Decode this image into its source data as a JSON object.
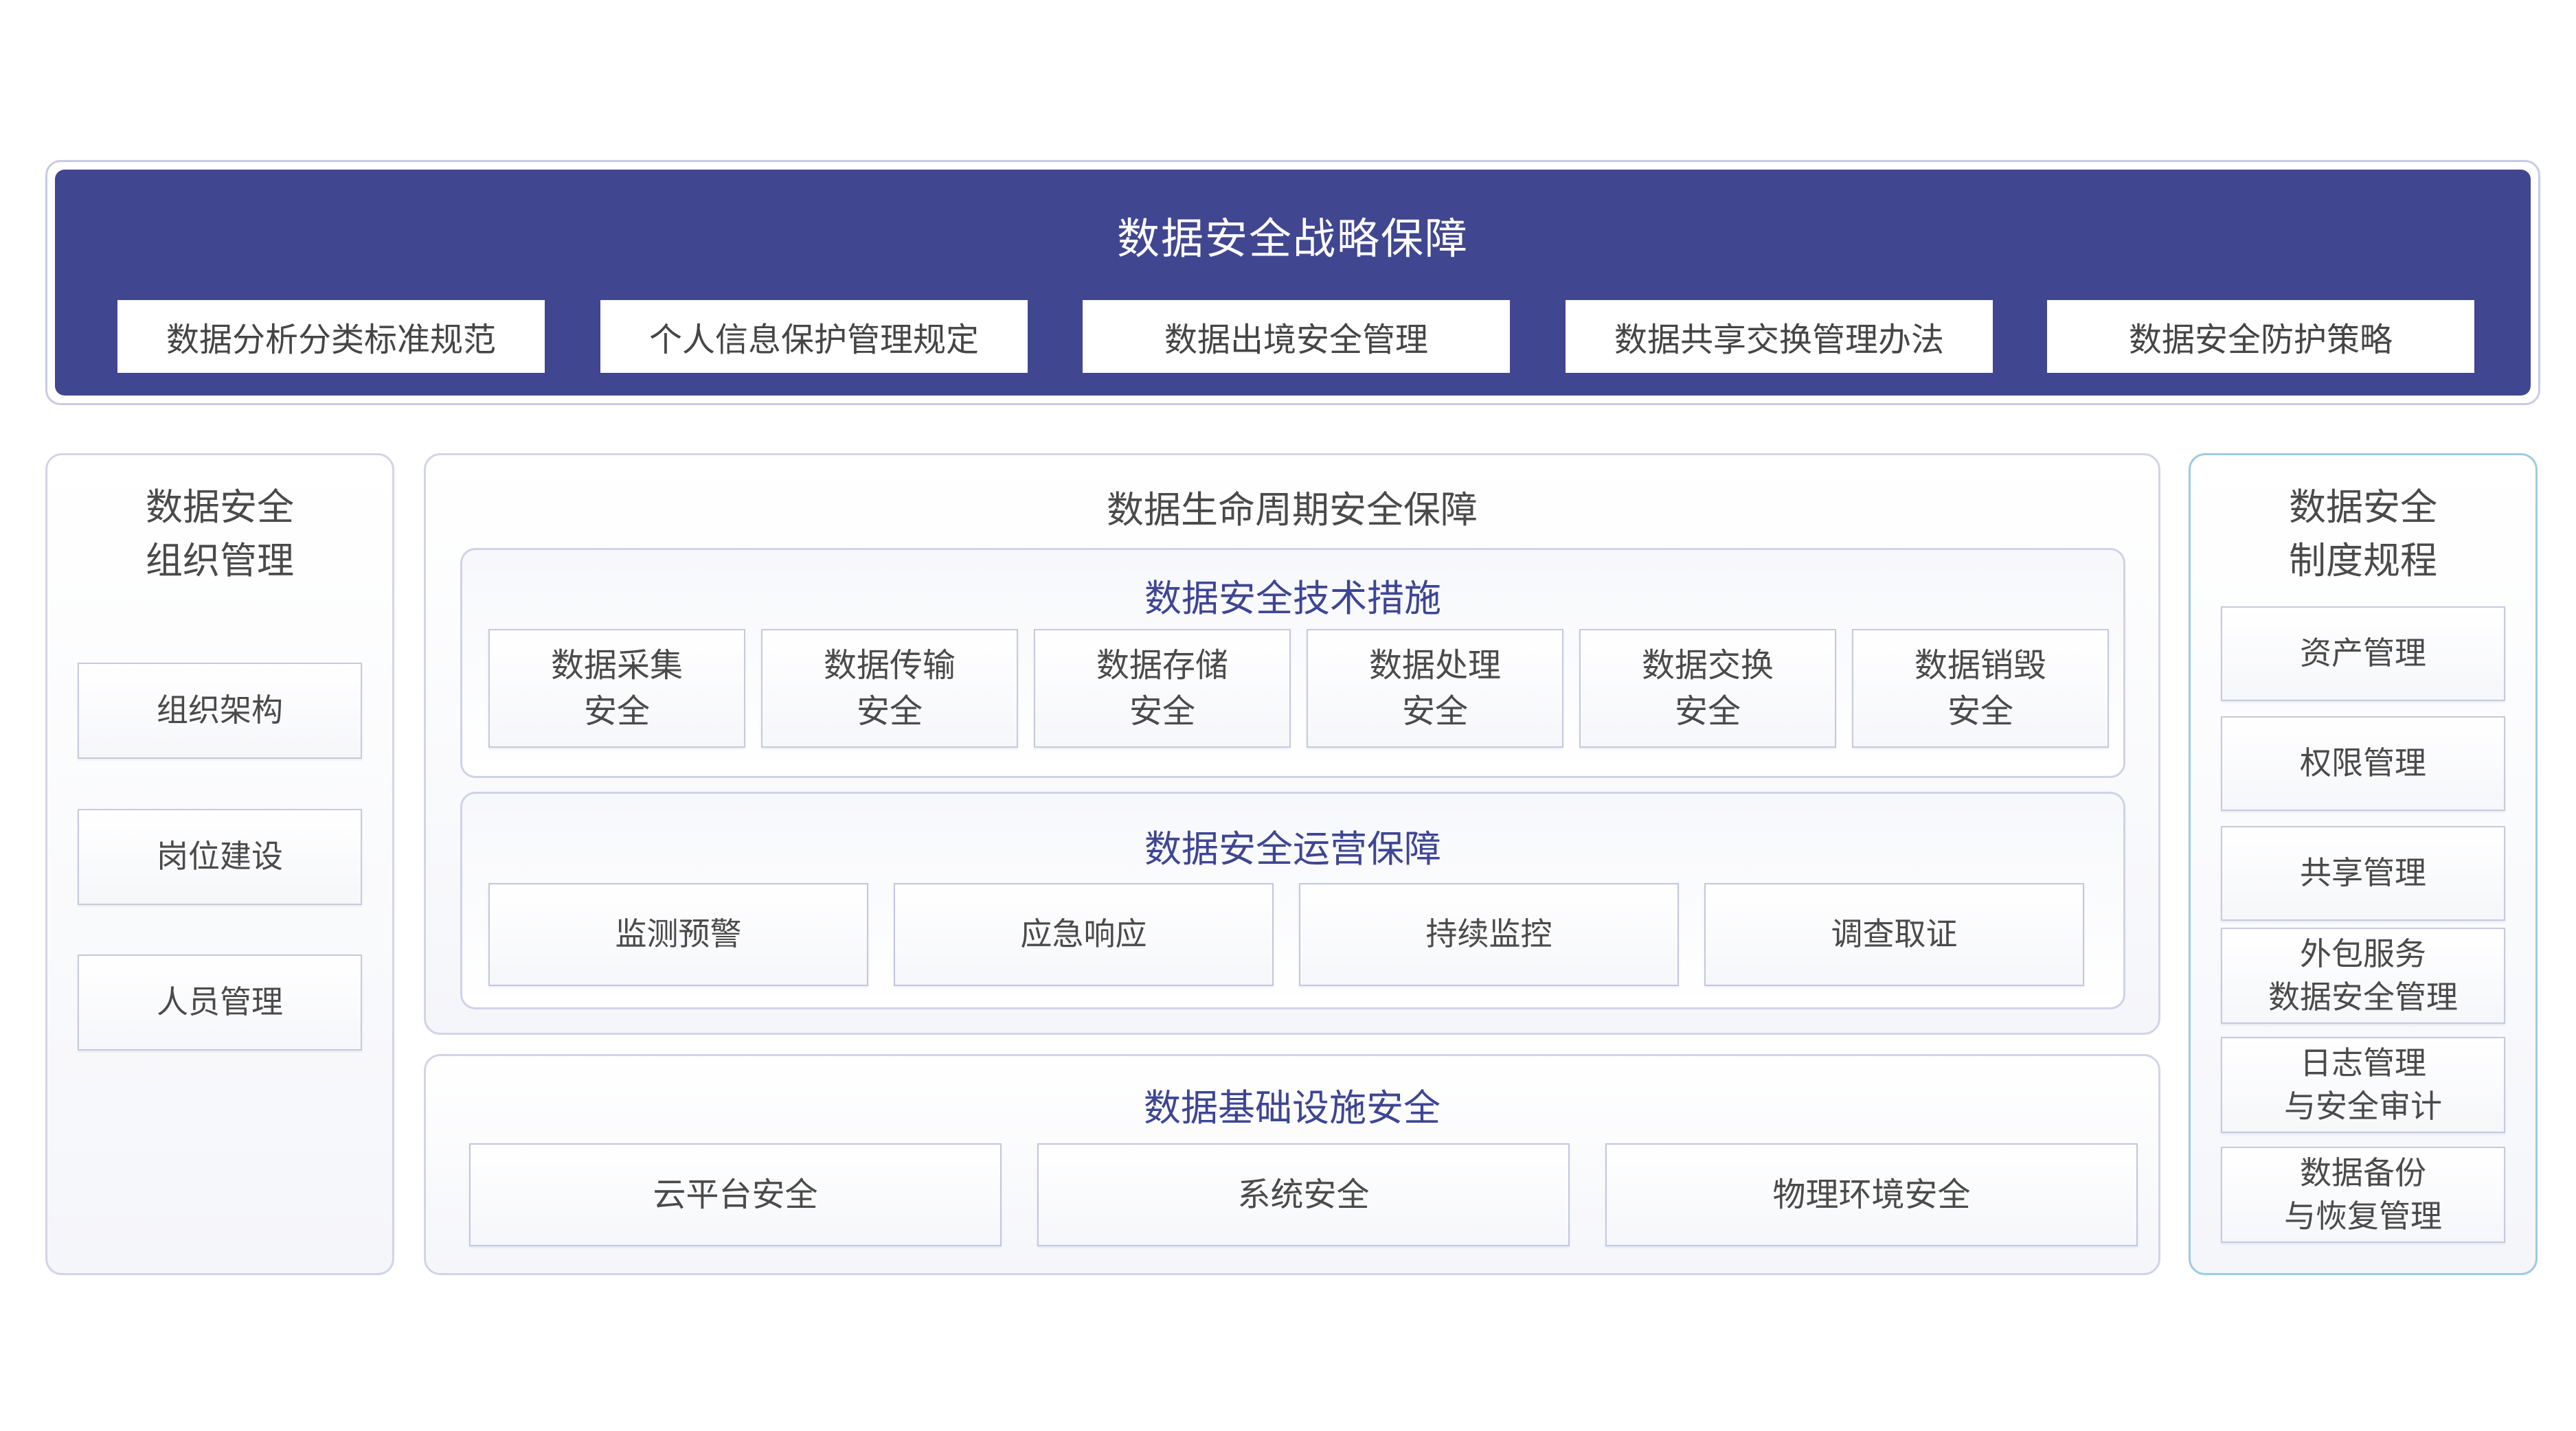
{
  "strategy": {
    "title": "数据安全战略保障",
    "items": [
      "数据分析分类标准规范",
      "个人信息保护管理规定",
      "数据出境安全管理",
      "数据共享交换管理办法",
      "数据安全防护策略"
    ]
  },
  "org": {
    "title_line1": "数据安全",
    "title_line2": "组织管理",
    "items": [
      "组织架构",
      "岗位建设",
      "人员管理"
    ]
  },
  "lifecycle": {
    "title": "数据生命周期安全保障",
    "tech": {
      "title": "数据安全技术措施",
      "items": [
        {
          "line1": "数据采集",
          "line2": "安全"
        },
        {
          "line1": "数据传输",
          "line2": "安全"
        },
        {
          "line1": "数据存储",
          "line2": "安全"
        },
        {
          "line1": "数据处理",
          "line2": "安全"
        },
        {
          "line1": "数据交换",
          "line2": "安全"
        },
        {
          "line1": "数据销毁",
          "line2": "安全"
        }
      ]
    },
    "ops": {
      "title": "数据安全运营保障",
      "items": [
        "监测预警",
        "应急响应",
        "持续监控",
        "调查取证"
      ]
    }
  },
  "infra": {
    "title": "数据基础设施安全",
    "items": [
      "云平台安全",
      "系统安全",
      "物理环境安全"
    ]
  },
  "policy": {
    "title_line1": "数据安全",
    "title_line2": "制度规程",
    "items": [
      {
        "line1": "资产管理",
        "line2": ""
      },
      {
        "line1": "权限管理",
        "line2": ""
      },
      {
        "line1": "共享管理",
        "line2": ""
      },
      {
        "line1": "外包服务",
        "line2": "数据安全管理"
      },
      {
        "line1": "日志管理",
        "line2": "与安全审计"
      },
      {
        "line1": "数据备份",
        "line2": "与恢复管理"
      }
    ]
  },
  "colors": {
    "strategy_band": "#414690",
    "accent_text": "#3e4593",
    "panel_border": "#d2d4e6",
    "right_panel_border": "#9fcbe0"
  }
}
